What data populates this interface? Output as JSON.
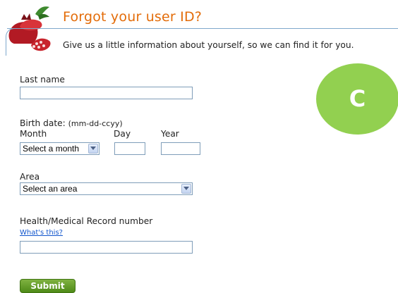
{
  "header": {
    "title": "Forgot your user ID?",
    "subtitle": "Give us a little information about yourself, so we can find it for you."
  },
  "form": {
    "last_name": {
      "label": "Last name",
      "value": ""
    },
    "birth_date": {
      "label": "Birth date:",
      "format_hint": "(mm-dd-ccyy)",
      "month_label": "Month",
      "month_selected": "Select a month",
      "day_label": "Day",
      "day_value": "",
      "year_label": "Year",
      "year_value": ""
    },
    "area": {
      "label": "Area",
      "selected": "Select an area"
    },
    "record_number": {
      "label": "Health/Medical Record number",
      "help_link": "What's this?",
      "value": ""
    },
    "submit_label": "Submit"
  },
  "badge": {
    "letter": "C",
    "color": "#92d050"
  },
  "colors": {
    "title": "#e36c09",
    "link": "#1155cc",
    "button": "#5a9a1e"
  },
  "icons": {
    "logo": "pomegranate-icon",
    "dropdown": "chevron-down-icon"
  }
}
